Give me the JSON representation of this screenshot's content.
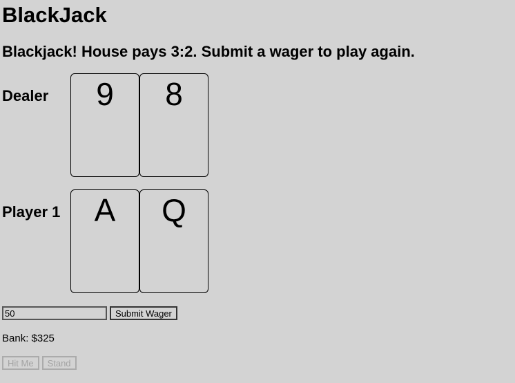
{
  "title": "BlackJack",
  "status_message": "Blackjack! House pays 3:2. Submit a wager to play again.",
  "dealer": {
    "label": "Dealer",
    "cards": [
      "9",
      "8"
    ]
  },
  "player": {
    "label": "Player 1",
    "cards": [
      "A",
      "Q"
    ]
  },
  "wager": {
    "value": "50",
    "submit_label": "Submit Wager"
  },
  "bank": {
    "text": "Bank: $325"
  },
  "actions": {
    "hit_label": "Hit Me",
    "stand_label": "Stand"
  }
}
